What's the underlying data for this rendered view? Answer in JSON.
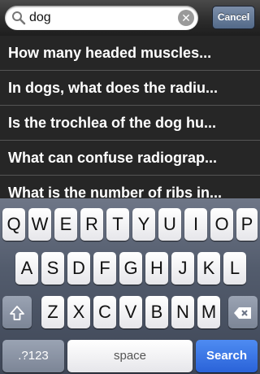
{
  "search": {
    "query": "dog",
    "cancel_label": "Cancel"
  },
  "results": [
    {
      "label": "How many headed muscles..."
    },
    {
      "label": "In dogs, what does the radiu..."
    },
    {
      "label": "Is the trochlea of the dog hu..."
    },
    {
      "label": "What can confuse radiograp..."
    },
    {
      "label": "What is the number of ribs in..."
    }
  ],
  "keyboard": {
    "row1": [
      "Q",
      "W",
      "E",
      "R",
      "T",
      "Y",
      "U",
      "I",
      "O",
      "P"
    ],
    "row2": [
      "A",
      "S",
      "D",
      "F",
      "G",
      "H",
      "J",
      "K",
      "L"
    ],
    "row3": [
      "Z",
      "X",
      "C",
      "V",
      "B",
      "N",
      "M"
    ],
    "numbers_label": ".?123",
    "space_label": "space",
    "search_label": "Search"
  },
  "colors": {
    "search_key": "#2a62d8",
    "cancel_button": "#536a89"
  },
  "icons": {
    "search": "search-icon",
    "clear": "clear-icon",
    "shift": "shift-icon",
    "delete": "delete-icon"
  }
}
